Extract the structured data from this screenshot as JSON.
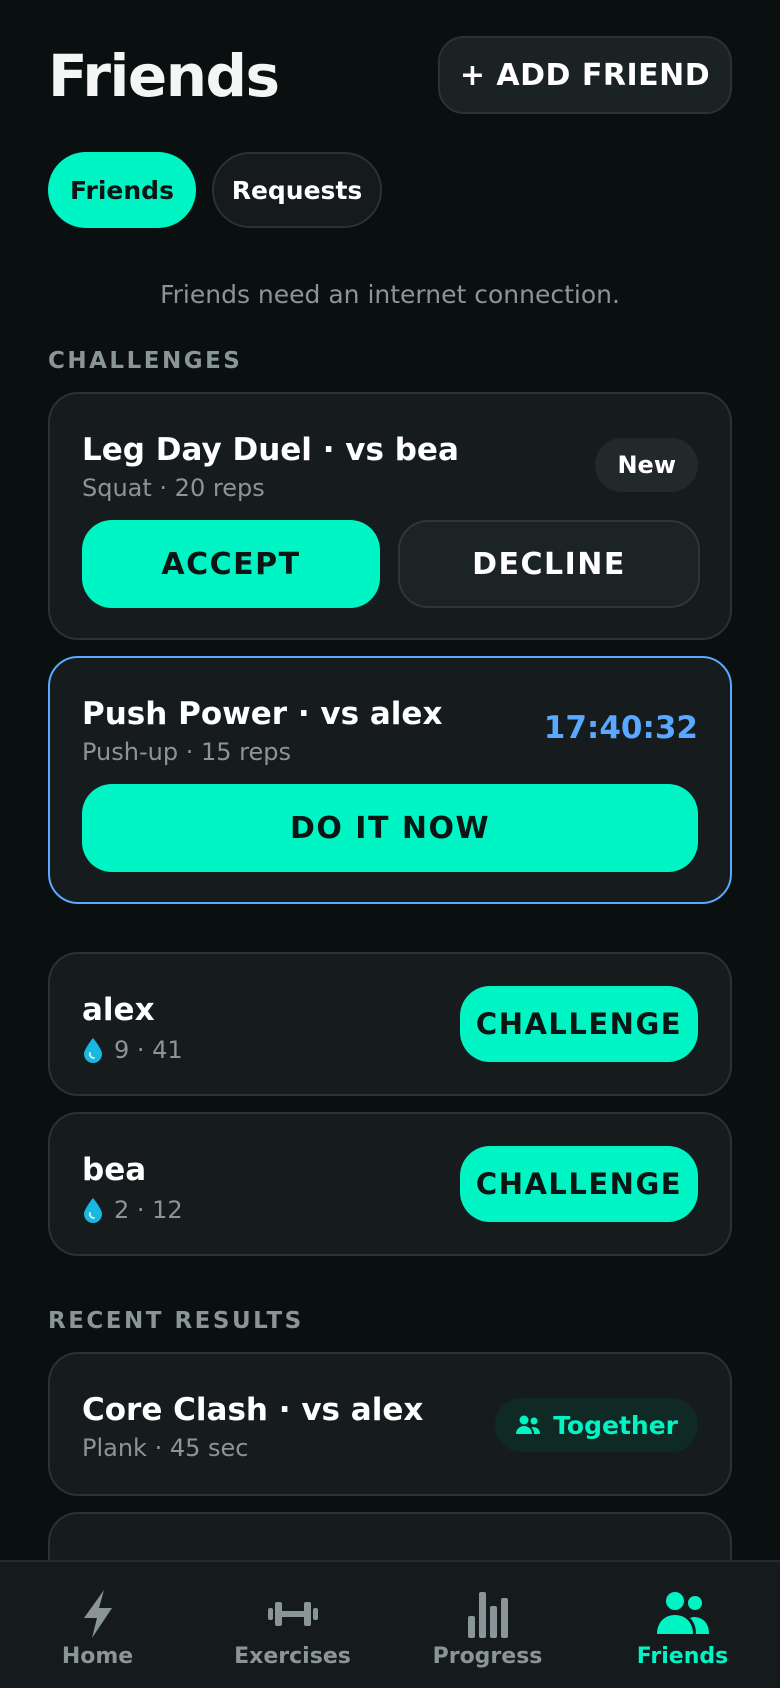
{
  "header": {
    "title": "Friends",
    "add_friend_label": "+ ADD FRIEND"
  },
  "tabs": [
    {
      "label": "Friends",
      "active": true
    },
    {
      "label": "Requests",
      "active": false
    }
  ],
  "notice": "Friends need an internet connection.",
  "challenges": {
    "section_label": "CHALLENGES",
    "items": [
      {
        "title": "Leg Day Duel · vs bea",
        "subtitle": "Squat · 20 reps",
        "badge": "New",
        "accept_label": "ACCEPT",
        "decline_label": "DECLINE"
      },
      {
        "title": "Push Power · vs alex",
        "subtitle": "Push-up · 15 reps",
        "timer": "17:40:32",
        "action_label": "DO IT NOW"
      }
    ]
  },
  "friends": [
    {
      "name": "alex",
      "stats": "9 · 41",
      "button_label": "CHALLENGE"
    },
    {
      "name": "bea",
      "stats": "2 · 12",
      "button_label": "CHALLENGE"
    }
  ],
  "recent_results": {
    "section_label": "RECENT RESULTS",
    "items": [
      {
        "title": "Core Clash · vs alex",
        "subtitle": "Plank · 45 sec",
        "badge": "Together"
      }
    ]
  },
  "bottom_nav": [
    {
      "label": "Home",
      "icon": "bolt-icon",
      "active": false
    },
    {
      "label": "Exercises",
      "icon": "dumbbell-icon",
      "active": false
    },
    {
      "label": "Progress",
      "icon": "bar-chart-icon",
      "active": false
    },
    {
      "label": "Friends",
      "icon": "people-icon",
      "active": true
    }
  ],
  "colors": {
    "accent": "#00f5c4",
    "timer": "#5aa8ff",
    "background": "#0a0f10",
    "card": "#161c1e"
  }
}
